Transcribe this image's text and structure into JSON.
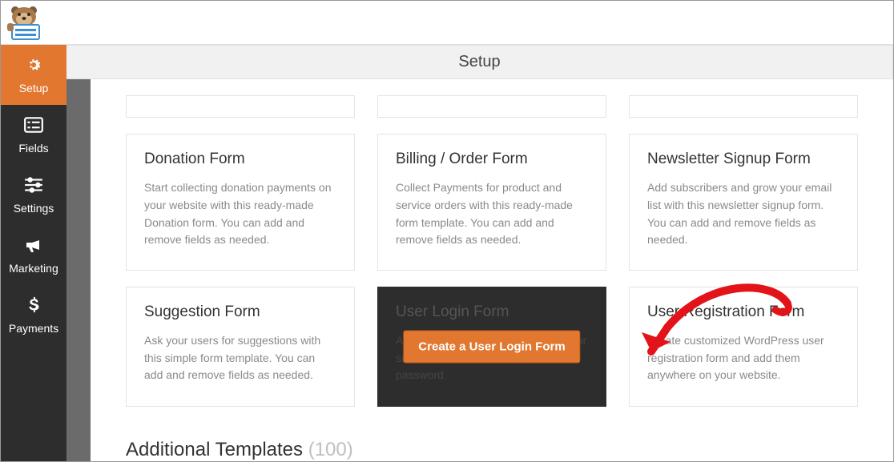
{
  "app": {
    "title": "Setup"
  },
  "sidebar": {
    "items": [
      {
        "label": "Setup"
      },
      {
        "label": "Fields"
      },
      {
        "label": "Settings"
      },
      {
        "label": "Marketing"
      },
      {
        "label": "Payments"
      }
    ]
  },
  "templates": {
    "row1": [
      {
        "title": "Donation Form",
        "desc": "Start collecting donation payments on your website with this ready-made Donation form. You can add and remove fields as needed."
      },
      {
        "title": "Billing / Order Form",
        "desc": "Collect Payments for product and service orders with this ready-made form template. You can add and remove fields as needed."
      },
      {
        "title": "Newsletter Signup Form",
        "desc": "Add subscribers and grow your email list with this newsletter signup form. You can add and remove fields as needed."
      }
    ],
    "row2": [
      {
        "title": "Suggestion Form",
        "desc": "Ask your users for suggestions with this simple form template. You can add and remove fields as needed."
      },
      {
        "title": "User Login Form",
        "desc": "Allow your users to easily login to your site with their username and password.",
        "cta": "Create a User Login Form"
      },
      {
        "title": "User Registration Form",
        "desc": "Create customized WordPress user registration form and add them anywhere on your website."
      }
    ]
  },
  "additional": {
    "label": "Additional Templates",
    "count": "(100)"
  }
}
